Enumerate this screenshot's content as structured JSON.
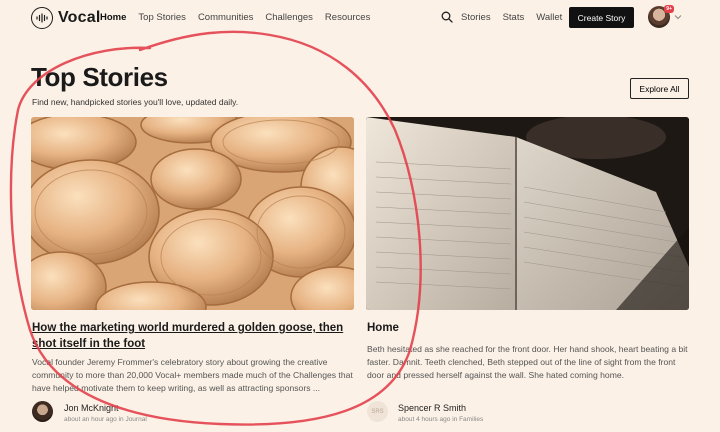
{
  "header": {
    "logo_text": "Vocal",
    "nav": [
      "Home",
      "Top Stories",
      "Communities",
      "Challenges",
      "Resources"
    ],
    "right_nav": [
      "Stories",
      "Stats",
      "Wallet"
    ],
    "create_label": "Create Story",
    "notification_count": "9+"
  },
  "page": {
    "title": "Top Stories",
    "subtitle": "Find new, handpicked stories you'll love, updated daily.",
    "explore_label": "Explore All"
  },
  "stories": [
    {
      "title": "How the marketing world murdered a golden goose, then shot itself in the foot",
      "excerpt": "Vocal founder Jeremy Frommer's celebratory story about growing the creative community to more than 20,000 Vocal+ members made much of the Challenges that have helped motivate them to keep writing, as well as attracting sponsors ...",
      "author": "Jon McKnight",
      "meta": "about an hour ago in Journal"
    },
    {
      "title": "Home",
      "excerpt": "Beth hesitated as she reached for the front door. Her hand shook, heart beating a bit faster.  Damnit. Teeth clenched, Beth stepped out of the line of sight from the front door and pressed herself against the wall. She hated coming home.",
      "author": "Spencer R Smith",
      "author_initials": "SRS",
      "meta": "about 4 hours ago in Families"
    }
  ],
  "colors": {
    "background": "#fbf1e6",
    "accent": "#111111",
    "annotation": "#e3404b"
  }
}
